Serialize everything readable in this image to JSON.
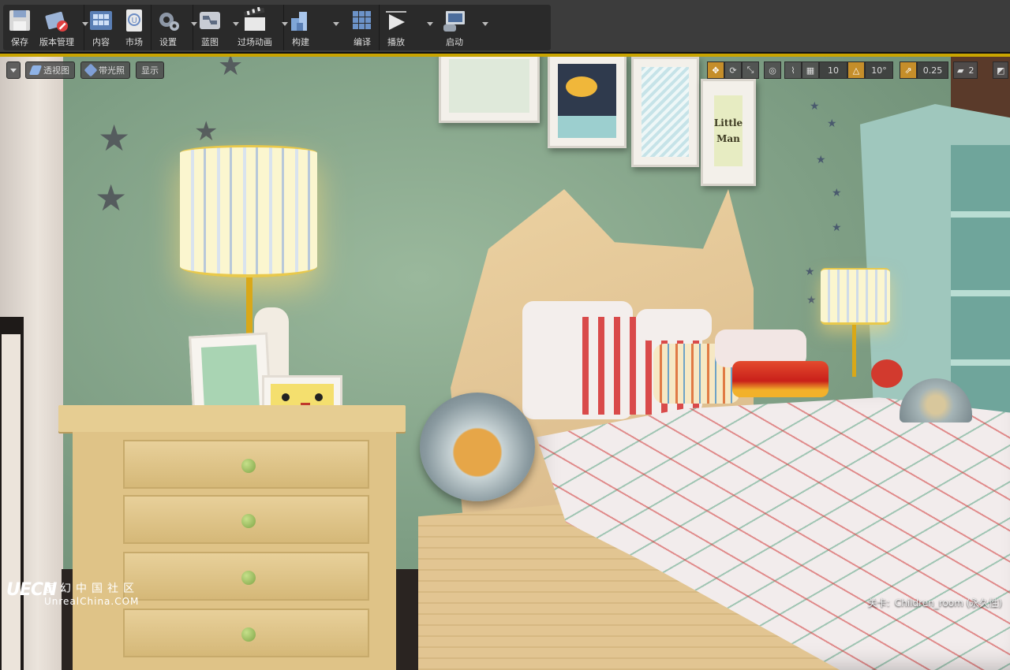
{
  "toolbar": {
    "items": [
      {
        "label": "保存",
        "icon": "save-icon",
        "has_dropdown": false
      },
      {
        "label": "版本管理",
        "icon": "source-control-icon",
        "has_dropdown": true
      },
      {
        "label": "内容",
        "icon": "content-icon",
        "has_dropdown": false
      },
      {
        "label": "市场",
        "icon": "marketplace-icon",
        "has_dropdown": false
      },
      {
        "label": "设置",
        "icon": "settings-icon",
        "has_dropdown": true
      },
      {
        "label": "蓝图",
        "icon": "blueprint-icon",
        "has_dropdown": true
      },
      {
        "label": "过场动画",
        "icon": "cinematics-icon",
        "has_dropdown": true
      },
      {
        "label": "构建",
        "icon": "build-icon",
        "has_dropdown": true
      },
      {
        "label": "编译",
        "icon": "compile-icon",
        "has_dropdown": false
      },
      {
        "label": "播放",
        "icon": "play-icon",
        "has_dropdown": true
      },
      {
        "label": "启动",
        "icon": "launch-icon",
        "has_dropdown": true
      }
    ]
  },
  "viewport": {
    "left_buttons": {
      "perspective": "透视图",
      "lit": "带光照",
      "show": "显示"
    },
    "right_controls": {
      "grid_snap_value": "10",
      "rotation_snap_value": "10°",
      "scale_snap_value": "0.25",
      "camera_speed_value": "2"
    },
    "frame_text": "Little Man",
    "frame_lines": [
      "Little",
      "Man"
    ]
  },
  "watermark": {
    "logo_mark": "UECN",
    "cn_text": "虚幻中国社区",
    "en_text": "UnrealChina.COM"
  },
  "status": {
    "level_label": "关卡:",
    "level_name": "Children_room (永久性)"
  },
  "colors": {
    "toolbar_bg": "#3c3c3c",
    "viewport_border": "#c9a400",
    "active_toggle": "#c58e2a",
    "wall": "#8aa88f"
  }
}
